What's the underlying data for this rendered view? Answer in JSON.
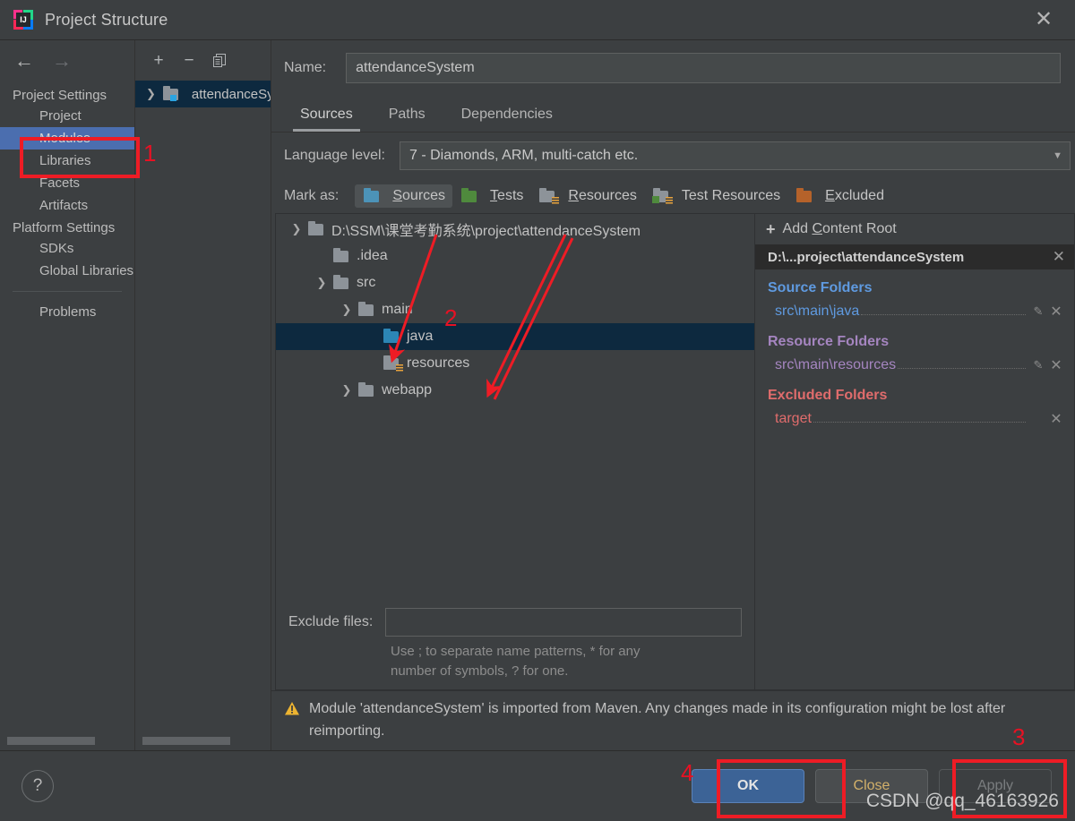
{
  "window": {
    "title": "Project Structure",
    "close_icon": "close-icon",
    "app_icon": "intellij-idea-logo"
  },
  "nav": {
    "back_icon": "arrow-left-icon",
    "forward_icon": "arrow-right-icon"
  },
  "sidebar": {
    "groups": [
      {
        "label": "Project Settings",
        "items": [
          {
            "label": "Project",
            "selected": false
          },
          {
            "label": "Modules",
            "selected": true
          },
          {
            "label": "Libraries",
            "selected": false
          },
          {
            "label": "Facets",
            "selected": false
          },
          {
            "label": "Artifacts",
            "selected": false
          }
        ]
      },
      {
        "label": "Platform Settings",
        "items": [
          {
            "label": "SDKs",
            "selected": false
          },
          {
            "label": "Global Libraries",
            "selected": false
          }
        ]
      }
    ],
    "problems": "Problems"
  },
  "modules_panel": {
    "toolbar": [
      {
        "name": "add-module-button",
        "glyph": "+"
      },
      {
        "name": "remove-module-button",
        "glyph": "−"
      },
      {
        "name": "copy-module-button",
        "glyph": "❐"
      }
    ],
    "items": [
      {
        "label": "attendanceSystem",
        "expanded": false,
        "selected": true
      }
    ]
  },
  "module_editor": {
    "name_label": "Name:",
    "name_value": "attendanceSystem",
    "tabs": [
      {
        "label": "Sources",
        "active": true
      },
      {
        "label": "Paths",
        "active": false
      },
      {
        "label": "Dependencies",
        "active": false
      }
    ],
    "language_level_label": "Language level:",
    "language_level_value": "7 - Diamonds, ARM, multi-catch etc.",
    "mark_as_label": "Mark as:",
    "mark_as_options": [
      {
        "label": "Sources",
        "mnemonic": "S",
        "color": "#4c93b8",
        "kind": "sources",
        "active": true
      },
      {
        "label": "Tests",
        "mnemonic": "T",
        "color": "#4f8a3d",
        "kind": "tests",
        "active": false
      },
      {
        "label": "Resources",
        "mnemonic": "R",
        "color": "#8d9399",
        "kind": "resources",
        "active": false
      },
      {
        "label": "Test Resources",
        "mnemonic": "",
        "color": "#8d9399",
        "kind": "test-resources",
        "active": false
      },
      {
        "label": "Excluded",
        "mnemonic": "E",
        "color": "#b5622a",
        "kind": "excluded",
        "active": false
      }
    ],
    "tree": [
      {
        "label": "D:\\SSM\\课堂考勤系统\\project\\attendanceSystem",
        "depth": 0,
        "chevron": "down",
        "kind": "plain",
        "selected": false
      },
      {
        "label": ".idea",
        "depth": 1,
        "chevron": "none",
        "kind": "plain",
        "selected": false
      },
      {
        "label": "src",
        "depth": 1,
        "chevron": "down",
        "kind": "plain",
        "selected": false
      },
      {
        "label": "main",
        "depth": 2,
        "chevron": "down",
        "kind": "plain",
        "selected": false
      },
      {
        "label": "java",
        "depth": 3,
        "chevron": "none",
        "kind": "sources",
        "selected": true
      },
      {
        "label": "resources",
        "depth": 3,
        "chevron": "none",
        "kind": "resources",
        "selected": false
      },
      {
        "label": "webapp",
        "depth": 2,
        "chevron": "right",
        "kind": "plain",
        "selected": false
      }
    ],
    "exclude_files_label": "Exclude files:",
    "exclude_files_value": "",
    "exclude_hint_line1": "Use ; to separate name patterns, * for any",
    "exclude_hint_line2": "number of symbols, ? for one."
  },
  "content_roots": {
    "add_label": "Add Content Root",
    "add_mnemonic": "C",
    "root_title": "D:\\...project\\attendanceSystem",
    "root_close_icon": "close-icon",
    "groups": [
      {
        "title": "Source Folders",
        "kind": "src",
        "color": "#5f9ae0",
        "rows": [
          {
            "path": "src\\main\\java",
            "has_edit": true,
            "has_remove": true
          }
        ]
      },
      {
        "title": "Resource Folders",
        "kind": "res",
        "color": "#a585c0",
        "rows": [
          {
            "path": "src\\main\\resources",
            "has_edit": true,
            "has_remove": true
          }
        ]
      },
      {
        "title": "Excluded Folders",
        "kind": "exc",
        "color": "#e06c6c",
        "rows": [
          {
            "path": "target",
            "has_edit": false,
            "has_remove": true
          }
        ]
      }
    ]
  },
  "warning": {
    "icon": "warning-triangle-icon",
    "line1": "Module 'attendanceSystem' is imported from Maven. Any changes made in its configuration",
    "line2": "might be lost after reimporting."
  },
  "footer": {
    "help_label": "?",
    "buttons": [
      {
        "label": "OK",
        "style": "primary"
      },
      {
        "label": "Close",
        "style": "ghost"
      },
      {
        "label": "Apply",
        "style": "disabled"
      }
    ]
  },
  "annotations": {
    "markers": [
      "1",
      "2",
      "3",
      "4"
    ],
    "color": "#ee1c25"
  },
  "watermark": "CSDN @qq_46163926"
}
